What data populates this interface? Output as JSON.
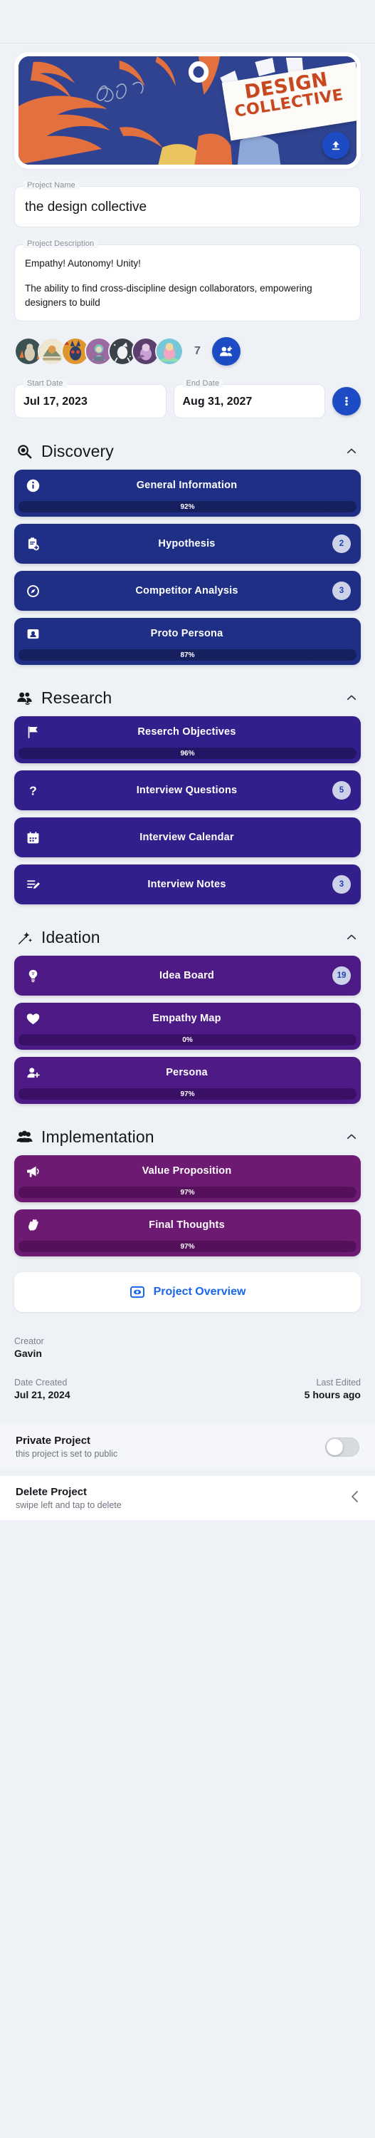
{
  "banner": {
    "alt_title_line1": "DESIGN",
    "alt_title_line2": "COLLECTIVE",
    "upload_icon": "upload-icon"
  },
  "project_name": {
    "label": "Project Name",
    "value": "the design collective"
  },
  "project_description": {
    "label": "Project Description",
    "line1": "Empathy! Autonomy! Unity!",
    "line2": "The ability to find cross-discipline design collaborators, empowering designers to build"
  },
  "members": {
    "count": "7",
    "add_icon": "add-person-icon",
    "avatars": [
      {
        "name": "avatar-1"
      },
      {
        "name": "avatar-2"
      },
      {
        "name": "avatar-3"
      },
      {
        "name": "avatar-4"
      },
      {
        "name": "avatar-5"
      },
      {
        "name": "avatar-6"
      },
      {
        "name": "avatar-7"
      }
    ]
  },
  "dates": {
    "start_label": "Start Date",
    "start_value": "Jul 17, 2023",
    "end_label": "End Date",
    "end_value": "Aug 31, 2027",
    "info_icon": "more-vertical-icon"
  },
  "sections": [
    {
      "id": "discovery",
      "title": "Discovery",
      "icon": "discovery-search-icon",
      "collapse_icon": "chevron-up-icon",
      "color": "#1f2f86",
      "progress_track": "#16205e",
      "progress_fill": "#16205e",
      "cards": [
        {
          "label": "General Information",
          "icon": "info-icon",
          "progress": "92%",
          "progress_value": 92,
          "badge": null
        },
        {
          "label": "Hypothesis",
          "icon": "clipboard-add-icon",
          "progress": null,
          "progress_value": null,
          "badge": "2"
        },
        {
          "label": "Competitor Analysis",
          "icon": "compass-icon",
          "progress": null,
          "progress_value": null,
          "badge": "3"
        },
        {
          "label": "Proto Persona",
          "icon": "id-card-icon",
          "progress": "87%",
          "progress_value": 87,
          "badge": null
        }
      ]
    },
    {
      "id": "research",
      "title": "Research",
      "icon": "research-people-icon",
      "collapse_icon": "chevron-up-icon",
      "color": "#331f8c",
      "progress_track": "#241464",
      "progress_fill": "#241464",
      "cards": [
        {
          "label": "Reserch Objectives",
          "icon": "flag-icon",
          "progress": "96%",
          "progress_value": 96,
          "badge": null
        },
        {
          "label": "Interview Questions",
          "icon": "question-mark-icon",
          "progress": null,
          "progress_value": null,
          "badge": "5"
        },
        {
          "label": "Interview Calendar",
          "icon": "calendar-icon",
          "progress": null,
          "progress_value": null,
          "badge": null
        },
        {
          "label": "Interview Notes",
          "icon": "notes-edit-icon",
          "progress": null,
          "progress_value": null,
          "badge": "3"
        }
      ]
    },
    {
      "id": "ideation",
      "title": "Ideation",
      "icon": "ideation-magic-icon",
      "collapse_icon": "chevron-up-icon",
      "color": "#4d1a86",
      "progress_track": "#3a1066",
      "progress_fill": "#3a1066",
      "cards": [
        {
          "label": "Idea Board",
          "icon": "lightbulb-icon",
          "progress": null,
          "progress_value": null,
          "badge": "19"
        },
        {
          "label": "Empathy Map",
          "icon": "heart-icon",
          "progress": "0%",
          "progress_value": 0,
          "badge": null
        },
        {
          "label": "Persona",
          "icon": "person-add-icon",
          "progress": "97%",
          "progress_value": 97,
          "badge": null
        }
      ]
    },
    {
      "id": "implementation",
      "title": "Implementation",
      "icon": "implementation-people-icon",
      "collapse_icon": "chevron-up-icon",
      "color": "#6d1a73",
      "progress_track": "#54105a",
      "progress_fill": "#54105a",
      "cards": [
        {
          "label": "Value Proposition",
          "icon": "megaphone-icon",
          "progress": "97%",
          "progress_value": 97,
          "badge": null
        },
        {
          "label": "Final Thoughts",
          "icon": "hand-wave-icon",
          "progress": "97%",
          "progress_value": 97,
          "badge": null
        }
      ]
    }
  ],
  "overview_button": {
    "label": "Project Overview",
    "icon": "eye-preview-icon"
  },
  "meta": {
    "creator_label": "Creator",
    "creator_value": "Gavin",
    "date_created_label": "Date Created",
    "date_created_value": "Jul 21, 2024",
    "last_edited_label": "Last Edited",
    "last_edited_value": "5 hours ago"
  },
  "settings": {
    "private_title": "Private Project",
    "private_sub": "this project is set to public",
    "private_toggle_on": false,
    "delete_title": "Delete Project",
    "delete_sub": "swipe left and tap to delete",
    "delete_chevron": "chevron-left-icon"
  },
  "colors": {
    "accent_blue": "#1c4bc4",
    "link_blue": "#1967e8",
    "page_bg": "#eef1f6"
  }
}
